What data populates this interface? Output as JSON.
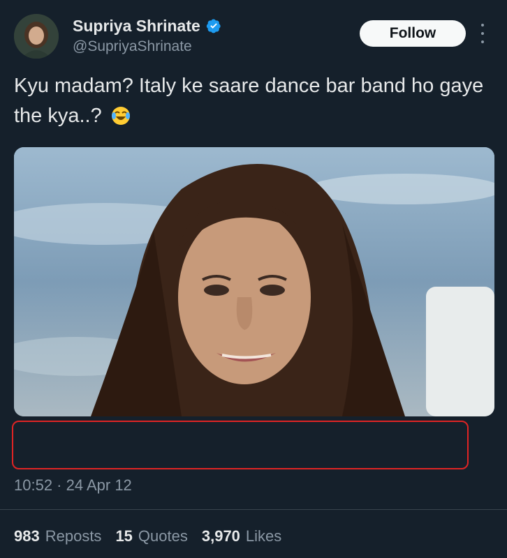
{
  "author": {
    "display_name": "Supriya Shrinate",
    "handle": "@SupriyaShrinate",
    "verified": true,
    "avatar_icon": "profile-photo"
  },
  "follow_label": "Follow",
  "more_icon": "more-vertical-icon",
  "tweet": {
    "text": "Kyu madam? Italy ke saare dance bar band ho gaye the kya..?",
    "emoji": "😂"
  },
  "media": {
    "kind": "photo"
  },
  "timestamp": "10:52 · 24 Apr 12",
  "stats": [
    {
      "count": "983",
      "label": "Reposts"
    },
    {
      "count": "15",
      "label": "Quotes"
    },
    {
      "count": "3,970",
      "label": "Likes"
    }
  ],
  "colors": {
    "background": "#15202b",
    "text": "#e7e9ea",
    "secondary_text": "#8b98a5",
    "verified": "#1d9bf0",
    "follow_bg": "#f7f9f9",
    "highlight": "#e02424"
  }
}
